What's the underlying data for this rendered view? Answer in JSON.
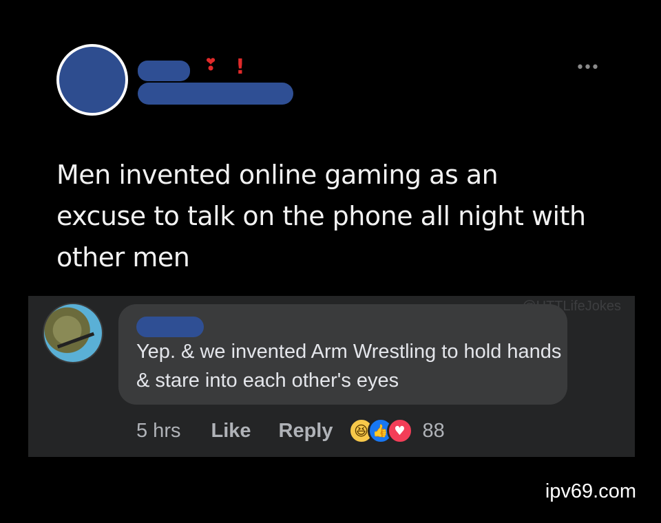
{
  "post": {
    "more_icon": "more-horizontal-icon",
    "heart_glyph": "❣",
    "exclaim_glyph": "!",
    "text": "Men invented online gaming as an excuse to talk on the phone all night with other men"
  },
  "comment": {
    "watermark": "@HTTLifeJokes",
    "text": "Yep. & we invented Arm Wrestling to hold hands & stare into each other's eyes",
    "time": "5 hrs",
    "like_label": "Like",
    "reply_label": "Reply",
    "reactions": [
      {
        "name": "haha",
        "glyph": "😆",
        "color": "#f7c84a"
      },
      {
        "name": "like",
        "glyph": "👍",
        "color": "#1877f2"
      },
      {
        "name": "love",
        "glyph": "♥",
        "color": "#f33e58"
      }
    ],
    "reaction_count": "88"
  },
  "site_watermark": "ipv69.com",
  "colors": {
    "background": "#000000",
    "comment_panel": "#242526",
    "bubble": "#3a3b3c",
    "redaction": "#2f4f94"
  }
}
